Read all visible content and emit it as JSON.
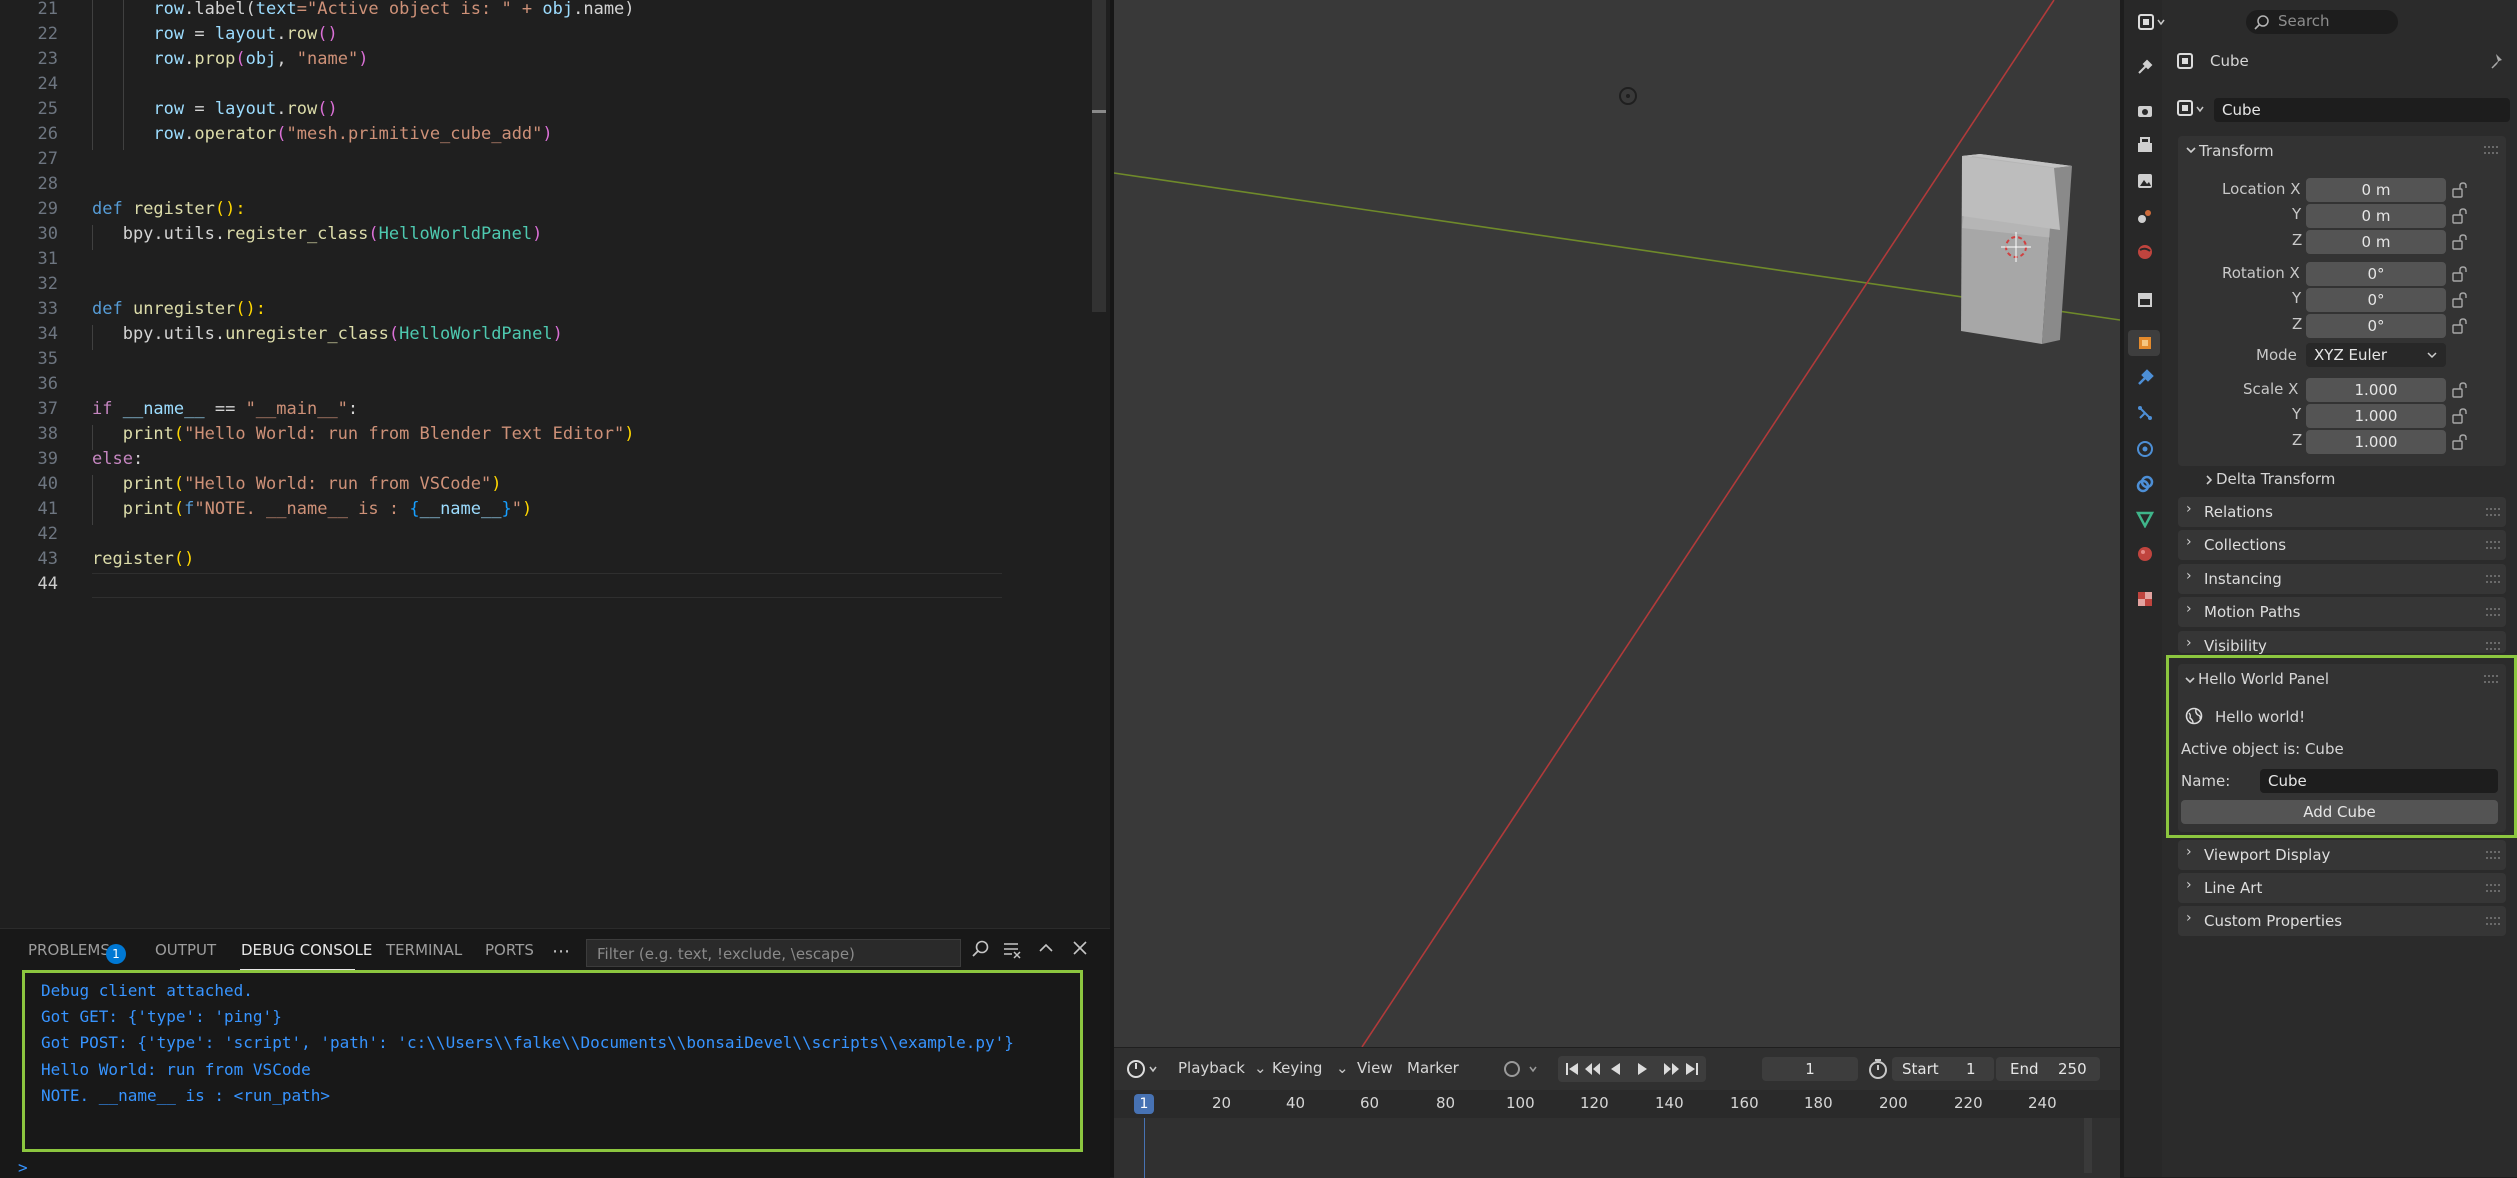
{
  "editor": {
    "lines": [
      {
        "n": "21",
        "tokens": [
          [
            "      ",
            "t"
          ],
          [
            "row",
            "t-var"
          ],
          [
            ".label(",
            "t"
          ],
          [
            "text",
            "t-var"
          ],
          [
            "=\"Active object is: \" + ",
            "t-str"
          ],
          [
            "obj",
            "t-var"
          ],
          [
            ".name)",
            "t"
          ]
        ]
      },
      {
        "n": "22",
        "tokens": [
          [
            "      ",
            "t"
          ],
          [
            "row",
            "t-var"
          ],
          [
            " = ",
            "t"
          ],
          [
            "layout",
            "t-var"
          ],
          [
            ".",
            "t"
          ],
          [
            "row",
            "t-fn"
          ],
          [
            "()",
            "t-p2"
          ]
        ]
      },
      {
        "n": "23",
        "tokens": [
          [
            "      ",
            "t"
          ],
          [
            "row",
            "t-var"
          ],
          [
            ".",
            "t"
          ],
          [
            "prop",
            "t-fn"
          ],
          [
            "(",
            "t-p2"
          ],
          [
            "obj",
            "t-var"
          ],
          [
            ", ",
            "t"
          ],
          [
            "\"name\"",
            "t-str"
          ],
          [
            ")",
            "t-p2"
          ]
        ]
      },
      {
        "n": "24",
        "tokens": []
      },
      {
        "n": "25",
        "tokens": [
          [
            "      ",
            "t"
          ],
          [
            "row",
            "t-var"
          ],
          [
            " = ",
            "t"
          ],
          [
            "layout",
            "t-var"
          ],
          [
            ".",
            "t"
          ],
          [
            "row",
            "t-fn"
          ],
          [
            "()",
            "t-p2"
          ]
        ]
      },
      {
        "n": "26",
        "tokens": [
          [
            "      ",
            "t"
          ],
          [
            "row",
            "t-var"
          ],
          [
            ".",
            "t"
          ],
          [
            "operator",
            "t-fn"
          ],
          [
            "(",
            "t-p2"
          ],
          [
            "\"mesh.primitive_cube_add\"",
            "t-str"
          ],
          [
            ")",
            "t-p2"
          ]
        ]
      },
      {
        "n": "27",
        "tokens": []
      },
      {
        "n": "28",
        "tokens": []
      },
      {
        "n": "29",
        "tokens": [
          [
            "def ",
            "t-kw"
          ],
          [
            "register",
            "t-fn"
          ],
          [
            "():",
            "t-p1"
          ]
        ]
      },
      {
        "n": "30",
        "tokens": [
          [
            "   bpy.utils.",
            "t"
          ],
          [
            "register_class",
            "t-fn"
          ],
          [
            "(",
            "t-p2"
          ],
          [
            "HelloWorldPanel",
            "t-cls"
          ],
          [
            ")",
            "t-p2"
          ]
        ]
      },
      {
        "n": "31",
        "tokens": []
      },
      {
        "n": "32",
        "tokens": []
      },
      {
        "n": "33",
        "tokens": [
          [
            "def ",
            "t-kw"
          ],
          [
            "unregister",
            "t-fn"
          ],
          [
            "():",
            "t-p1"
          ]
        ]
      },
      {
        "n": "34",
        "tokens": [
          [
            "   bpy.utils.",
            "t"
          ],
          [
            "unregister_class",
            "t-fn"
          ],
          [
            "(",
            "t-p2"
          ],
          [
            "HelloWorldPanel",
            "t-cls"
          ],
          [
            ")",
            "t-p2"
          ]
        ]
      },
      {
        "n": "35",
        "tokens": []
      },
      {
        "n": "36",
        "tokens": []
      },
      {
        "n": "37",
        "tokens": [
          [
            "if ",
            "t-ctl"
          ],
          [
            "__name__",
            "t-var"
          ],
          [
            " == ",
            "t"
          ],
          [
            "\"__main__\"",
            "t-str"
          ],
          [
            ":",
            "t"
          ]
        ]
      },
      {
        "n": "38",
        "tokens": [
          [
            "   ",
            "t"
          ],
          [
            "print",
            "t-fn"
          ],
          [
            "(",
            "t-p1"
          ],
          [
            "\"Hello World: run from Blender Text Editor\"",
            "t-str"
          ],
          [
            ")",
            "t-p1"
          ]
        ]
      },
      {
        "n": "39",
        "tokens": [
          [
            "else",
            "t-ctl"
          ],
          [
            ":",
            "t"
          ]
        ]
      },
      {
        "n": "40",
        "tokens": [
          [
            "   ",
            "t"
          ],
          [
            "print",
            "t-fn"
          ],
          [
            "(",
            "t-p1"
          ],
          [
            "\"Hello World: run from VSCode\"",
            "t-str"
          ],
          [
            ")",
            "t-p1"
          ]
        ]
      },
      {
        "n": "41",
        "tokens": [
          [
            "   ",
            "t"
          ],
          [
            "print",
            "t-fn"
          ],
          [
            "(",
            "t-p1"
          ],
          [
            "f",
            "t-kw"
          ],
          [
            "\"NOTE. __name__ is : ",
            "t-str"
          ],
          [
            "{",
            "t-p3"
          ],
          [
            "__name__",
            "t-var"
          ],
          [
            "}",
            "t-p3"
          ],
          [
            "\"",
            "t-str"
          ],
          [
            ")",
            "t-p1"
          ]
        ]
      },
      {
        "n": "42",
        "tokens": []
      },
      {
        "n": "43",
        "tokens": [
          [
            "register",
            "t-fn"
          ],
          [
            "()",
            "t-p1"
          ]
        ]
      },
      {
        "n": "44",
        "tokens": []
      }
    ]
  },
  "panel": {
    "tabs": {
      "problems": "PROBLEMS",
      "problems_count": "1",
      "output": "OUTPUT",
      "debug": "DEBUG CONSOLE",
      "terminal": "TERMINAL",
      "ports": "PORTS"
    },
    "filter_placeholder": "Filter (e.g. text, !exclude, \\escape)",
    "console": [
      "Debug client attached.",
      "Got GET: {'type': 'ping'}",
      "Got POST: {'type': 'script', 'path': 'c:\\\\Users\\\\falke\\\\Documents\\\\bonsaiDevel\\\\scripts\\\\example.py'}",
      "Hello World: run from VSCode",
      "NOTE. __name__ is : <run_path>"
    ],
    "prompt": ">"
  },
  "timeline": {
    "menus": {
      "playback": "Playback",
      "keying": "Keying",
      "view": "View",
      "marker": "Marker"
    },
    "current_frame": "1",
    "start_label": "Start",
    "start": "1",
    "end_label": "End",
    "end": "250",
    "ruler": [
      "1",
      "20",
      "40",
      "60",
      "80",
      "100",
      "120",
      "140",
      "160",
      "180",
      "200",
      "220",
      "240"
    ]
  },
  "props": {
    "search_placeholder": "Search",
    "object_name": "Cube",
    "name_field": "Cube",
    "transform": {
      "title": "Transform",
      "location_label": "Location X",
      "y": "Y",
      "z": "Z",
      "loc_x": "0 m",
      "loc_y": "0 m",
      "loc_z": "0 m",
      "rotation_label": "Rotation X",
      "rot_x": "0°",
      "rot_y": "0°",
      "rot_z": "0°",
      "mode_label": "Mode",
      "mode": "XYZ Euler",
      "scale_label": "Scale X",
      "scale_x": "1.000",
      "scale_y": "1.000",
      "scale_z": "1.000",
      "delta": "Delta Transform"
    },
    "sections": {
      "relations": "Relations",
      "collections": "Collections",
      "instancing": "Instancing",
      "motion_paths": "Motion Paths",
      "visibility": "Visibility",
      "viewport_display": "Viewport Display",
      "line_art": "Line Art",
      "custom_properties": "Custom Properties"
    },
    "hello": {
      "title": "Hello World Panel",
      "greeting": "Hello world!",
      "active": "Active object is: Cube",
      "name_label": "Name:",
      "name_value": "Cube",
      "button": "Add Cube"
    }
  },
  "colors": {
    "highlight_border": "#8cc63f",
    "console_text": "#3794ff",
    "blender_accent": "#4772b3"
  }
}
